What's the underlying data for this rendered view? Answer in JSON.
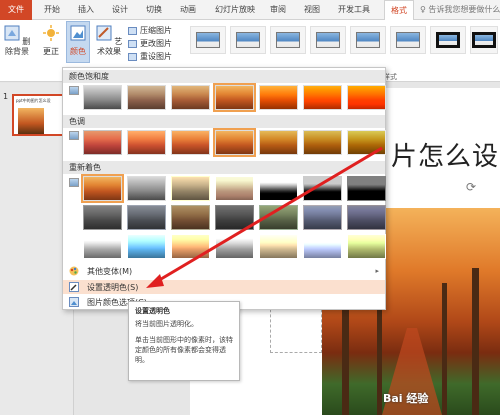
{
  "tabs": [
    "文件",
    "开始",
    "插入",
    "设计",
    "切换",
    "动画",
    "幻灯片放映",
    "审阅",
    "视图",
    "开发工具",
    "格式"
  ],
  "search_placeholder": "告诉我您想要做什么",
  "ribbon": {
    "remove_bg": "删除背景",
    "corrections": "更正",
    "color": "颜色",
    "art_effects": "艺术效果",
    "compress": "压缩图片",
    "change": "更改图片",
    "reset": "重设图片",
    "group_label": "片样式"
  },
  "thumb_num": "1",
  "thumb_text": "ppt中的图片怎么设",
  "slide_title": "片怎么设",
  "dropdown": {
    "saturation": "颜色饱和度",
    "tone": "色调",
    "recolor": "重新着色",
    "more": "其他变体(M)",
    "set_transparent": "设置透明色(S)",
    "picture_options": "图片颜色选项(C)..."
  },
  "tooltip": {
    "title": "设置透明色",
    "line1": "将当前图片透明化。",
    "line2": "单击当前图形中的像素时，该特定颜色的所有像素都会变得透明。"
  },
  "watermark": "Bai 经验",
  "colors": {
    "accent": "#d24726",
    "highlight": "#fbe0cf",
    "arrow": "#e02020"
  }
}
